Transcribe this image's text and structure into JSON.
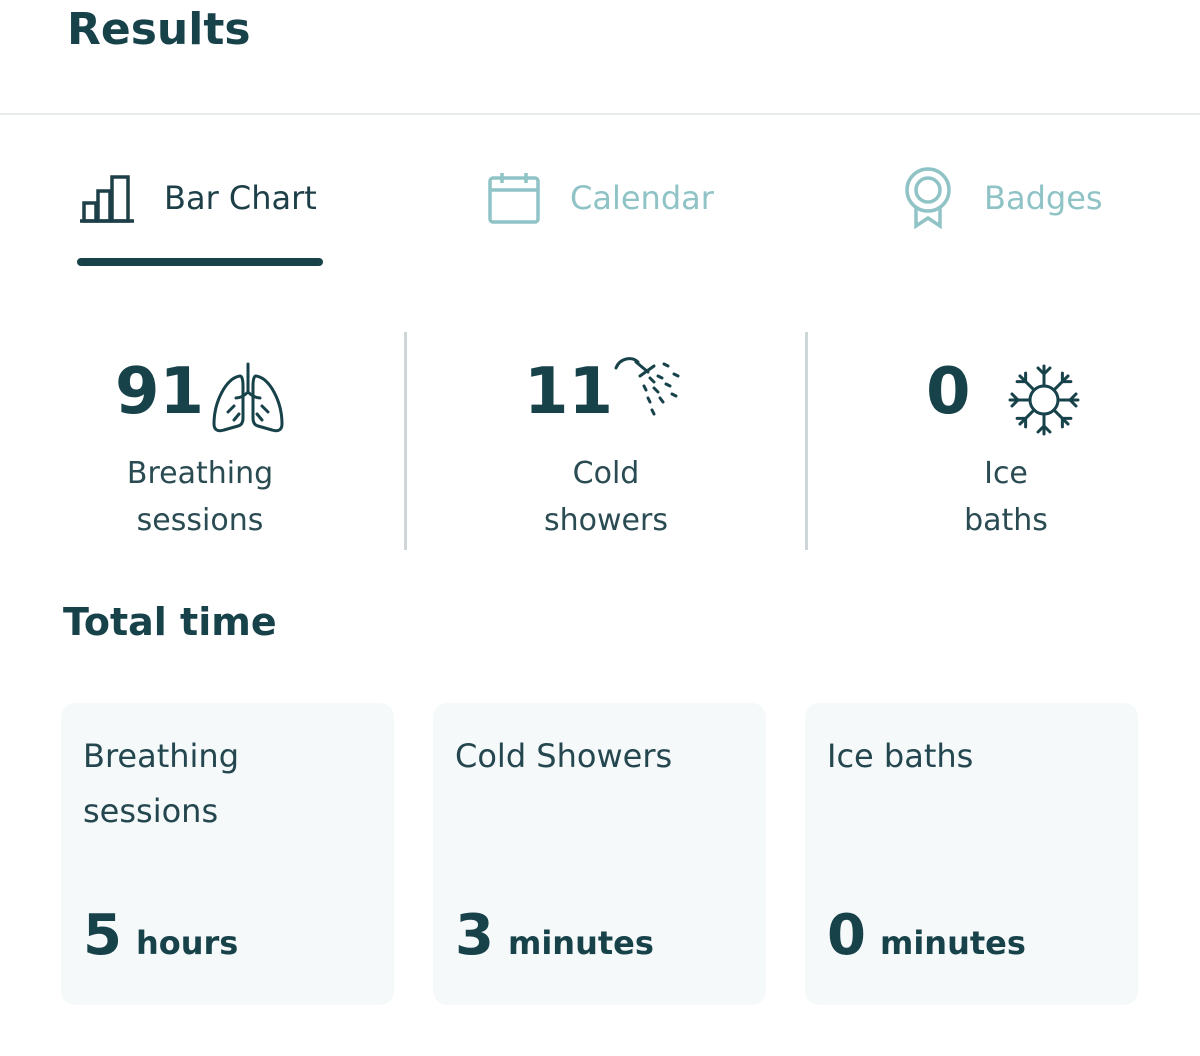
{
  "header": {
    "title": "Results"
  },
  "tabs": [
    {
      "label": "Bar Chart",
      "icon": "bar-chart-icon",
      "active": true
    },
    {
      "label": "Calendar",
      "icon": "calendar-icon",
      "active": false
    },
    {
      "label": "Badges",
      "icon": "badge-icon",
      "active": false
    }
  ],
  "stats": [
    {
      "value": "91",
      "label_line1": "Breathing",
      "label_line2": "sessions",
      "icon": "lungs-icon"
    },
    {
      "value": "11",
      "label_line1": "Cold",
      "label_line2": "showers",
      "icon": "shower-icon"
    },
    {
      "value": "0",
      "label_line1": "Ice",
      "label_line2": "baths",
      "icon": "snowflake-icon"
    }
  ],
  "total_time": {
    "title": "Total time",
    "cards": [
      {
        "title_line1": "Breathing",
        "title_line2": "sessions",
        "value": "5",
        "unit": "hours"
      },
      {
        "title_line1": "Cold Showers",
        "title_line2": "",
        "value": "3",
        "unit": "minutes"
      },
      {
        "title_line1": "Ice baths",
        "title_line2": "",
        "value": "0",
        "unit": "minutes"
      }
    ]
  },
  "colors": {
    "primary": "#17424a",
    "inactive_tab": "#8fc3c6",
    "card_bg": "#f5f9fa",
    "divider": "#cfd6d8"
  }
}
